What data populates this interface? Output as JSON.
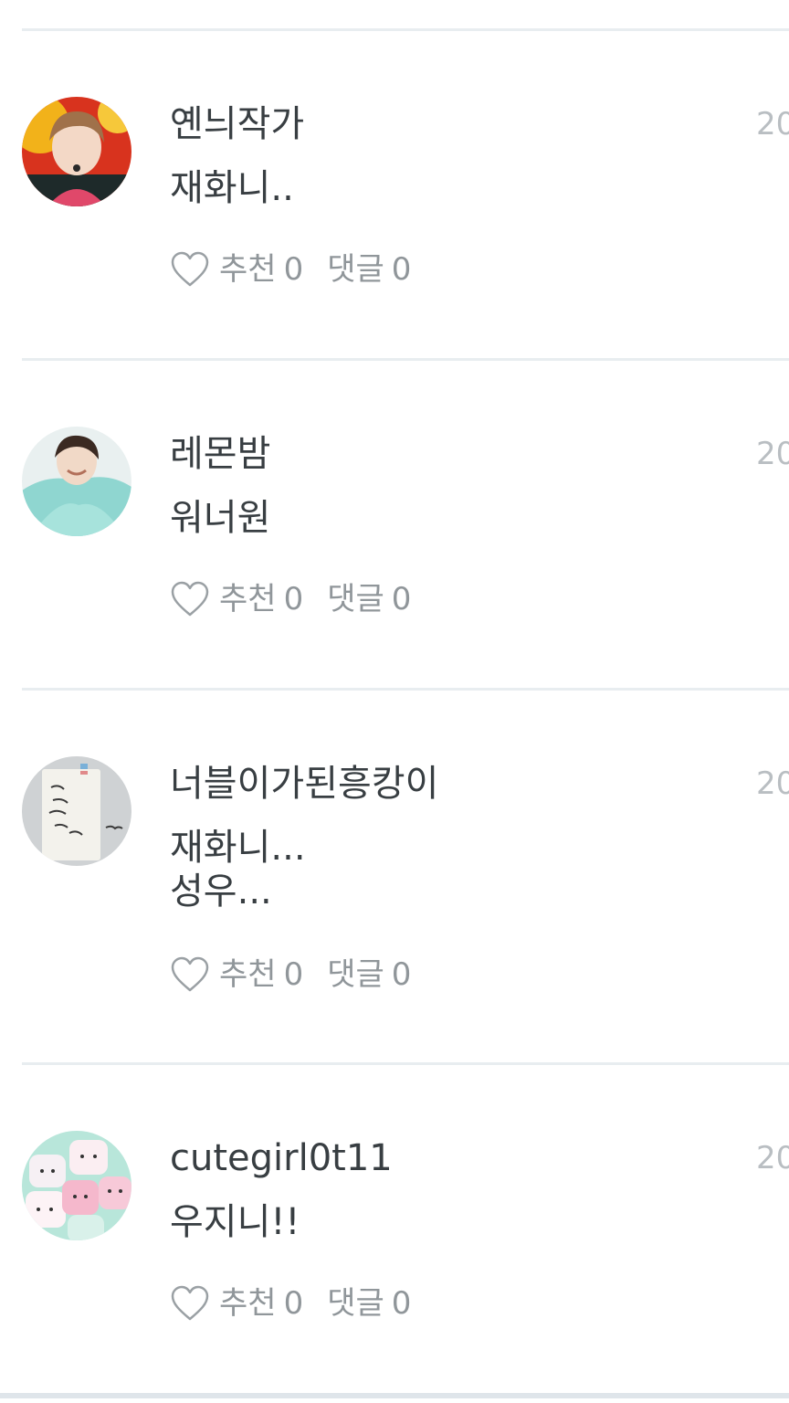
{
  "comments": [
    {
      "username": "옌늬작가",
      "date": "20",
      "text": "재화니..",
      "like_label": "추천",
      "like_count": "0",
      "reply_label": "댓글",
      "reply_count": "0"
    },
    {
      "username": "레몬밤",
      "date": "20",
      "text": "워너원",
      "like_label": "추천",
      "like_count": "0",
      "reply_label": "댓글",
      "reply_count": "0"
    },
    {
      "username": "너블이가된흥캉이",
      "date": "20",
      "text": "재화니...\n성우...",
      "like_label": "추천",
      "like_count": "0",
      "reply_label": "댓글",
      "reply_count": "0"
    },
    {
      "username": "cutegirl0t11",
      "date": "20",
      "text": "우지니!!",
      "like_label": "추천",
      "like_count": "0",
      "reply_label": "댓글",
      "reply_count": "0"
    }
  ]
}
